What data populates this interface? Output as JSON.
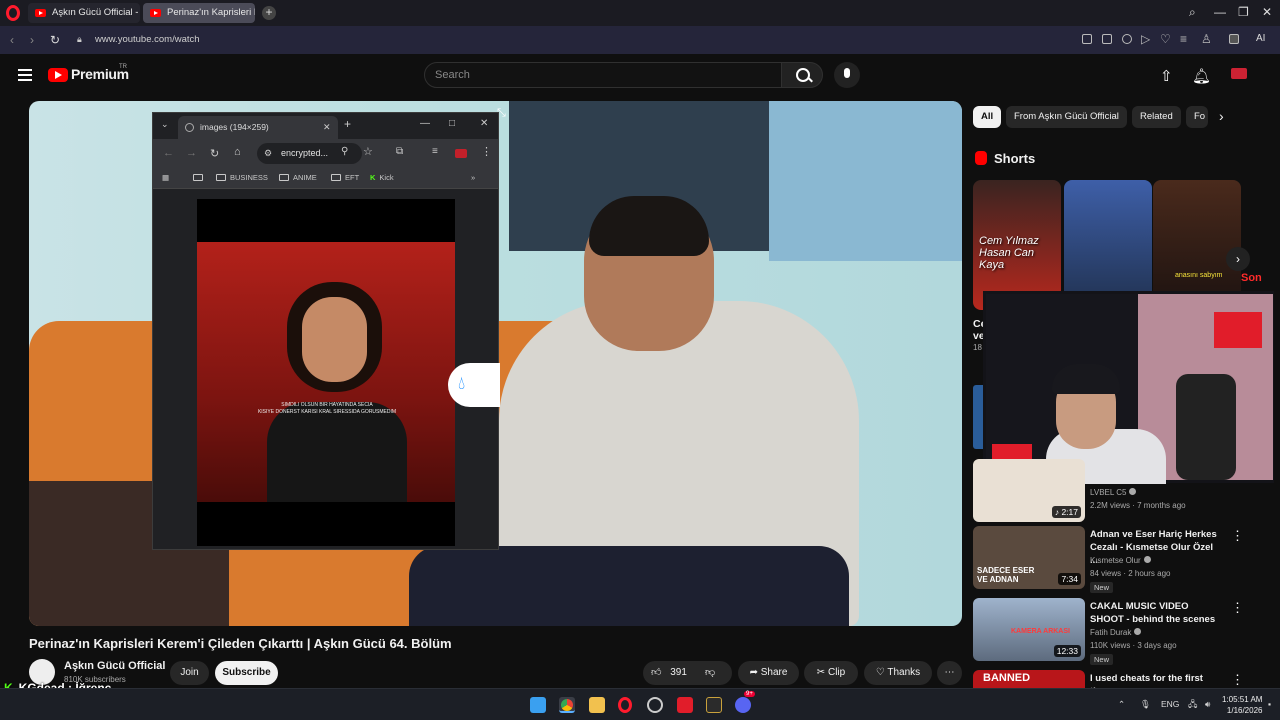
{
  "browser": {
    "tabs": [
      {
        "label": "Aşkın Gücü Official - YouTu"
      },
      {
        "label": "Perinaz'ın Kaprisleri Kerem"
      }
    ],
    "url": "www.youtube.com/watch",
    "ai_label": "AI"
  },
  "youtube": {
    "brand": "Premium",
    "country": "TR",
    "search_placeholder": "Search"
  },
  "popup": {
    "tab_title": "images (194×259)",
    "address": "encrypted...",
    "bookmarks": [
      "BUSINESS",
      "ANIME",
      "EFT",
      "Kick"
    ],
    "overflow": "»",
    "caption_line1": "SIMDILI OLSUN BIR HAYATINDA SECIA",
    "caption_line2": "KISIYE DONERST KARISI KRAL SIRESSIDA GORUSMEDIM"
  },
  "video": {
    "title": "Perinaz'ın Kaprisleri Kerem'i Çileden Çıkarttı | Aşkın Gücü 64. Bölüm",
    "channel": "Aşkın Gücü Official",
    "subscribers": "810K subscribers",
    "join_label": "Join",
    "subscribe_label": "Subscribe",
    "likes": "391",
    "share_label": "Share",
    "clip_label": "Clip",
    "thanks_label": "Thanks"
  },
  "chat_overlay": {
    "text": "KGdead : İğrenç"
  },
  "sidebar": {
    "chips": [
      "All",
      "From Aşkın Gücü Official",
      "Related",
      "Fo"
    ],
    "shorts_heading": "Shorts",
    "shorts_thumb_text": "Cem Yılmaz Hasan Can Kaya",
    "shorts_thumb_text2": "anasını sabyım",
    "shorts_thumb_badge": "Son",
    "shorts_cut_title_line1": "Ce",
    "shorts_cut_title_line2": "ve",
    "shorts_cut_views": "18",
    "videos": [
      {
        "title": "",
        "channel": "LVBEL C5",
        "meta": "2.2M views · 7 months ago",
        "duration": "2:17",
        "thumb_color": "#e9e0d4",
        "new": ""
      },
      {
        "title": "Adnan ve Eser Hariç Herkes Cezalı - Kısmetse Olur Özel ...",
        "channel": "Kısmetse Olur",
        "meta": "84 views · 2 hours ago",
        "duration": "7:34",
        "thumb_color": "#5a4a3e",
        "thumb_text": "SADECE ESER VE ADNAN",
        "new": "New"
      },
      {
        "title": "CAKAL MUSIC VIDEO SHOOT - behind the scenes",
        "channel": "Fatih Durak",
        "meta": "110K views · 3 days ago",
        "duration": "12:33",
        "thumb_color": "#7d8ea8",
        "thumb_text": "KAMERA ARKASI",
        "new": "New"
      },
      {
        "title": "I used cheats for the first time",
        "channel": "",
        "meta": "",
        "duration": "",
        "thumb_color": "#b8161a",
        "thumb_text": "BANNED",
        "new": ""
      }
    ]
  },
  "taskbar": {
    "lang": "ENG",
    "time": "1:05:51 AM",
    "date": "1/16/2026",
    "discord_badge": "9+"
  },
  "colors": {
    "youtube_red": "#ff0000",
    "opera_red": "#ff1b2d",
    "kick_green": "#53fc18"
  }
}
